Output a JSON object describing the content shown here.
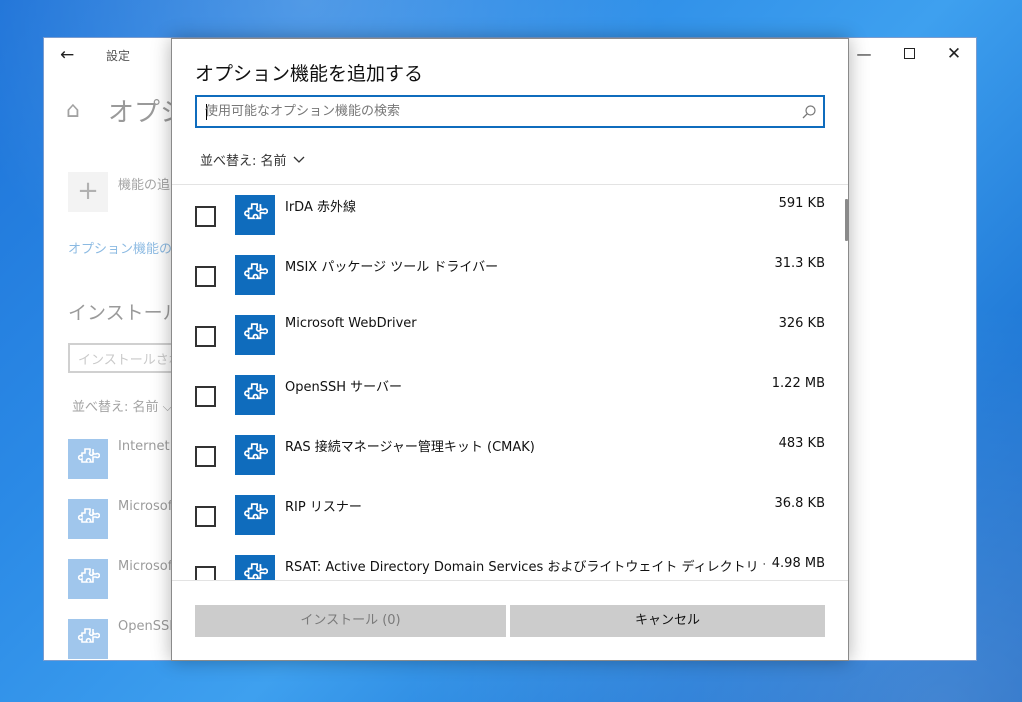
{
  "settings": {
    "back_glyph": "←",
    "title": "設定",
    "min_glyph": "—",
    "close_glyph": "✕",
    "home_glyph": "⌂",
    "page_title": "オプシ",
    "plus_glyph": "+",
    "add_feature": "機能の追",
    "history_link": "オプション機能の履",
    "installed_heading": "インストールさ",
    "installed_search_placeholder": "インストールされて",
    "installed_sort": "並べ替え: 名前 ⌵",
    "items": [
      {
        "name": "Internet"
      },
      {
        "name": "Microsof"
      },
      {
        "name": "Microsof"
      },
      {
        "name": "OpenSSH"
      }
    ]
  },
  "dialog": {
    "title": "オプション機能を追加する",
    "search_placeholder": "使用可能なオプション機能の検索",
    "sort_label": "並べ替え: 名前",
    "features": [
      {
        "name": "IrDA 赤外線",
        "size": "591 KB"
      },
      {
        "name": "MSIX パッケージ ツール ドライバー",
        "size": "31.3 KB"
      },
      {
        "name": "Microsoft WebDriver",
        "size": "326 KB"
      },
      {
        "name": "OpenSSH サーバー",
        "size": "1.22 MB"
      },
      {
        "name": "RAS 接続マネージャー管理キット (CMAK)",
        "size": "483 KB"
      },
      {
        "name": "RIP リスナー",
        "size": "36.8 KB"
      },
      {
        "name": "RSAT: Active Directory Domain Services およびライトウェイト ディレクトリ サービス ツール",
        "size": "4.98 MB"
      }
    ],
    "install_button": "インストール (0)",
    "cancel_button": "キャンセル"
  },
  "colors": {
    "accent": "#0f6cbd",
    "tile_bg": "#0f6cbd",
    "link": "#0067c0"
  }
}
